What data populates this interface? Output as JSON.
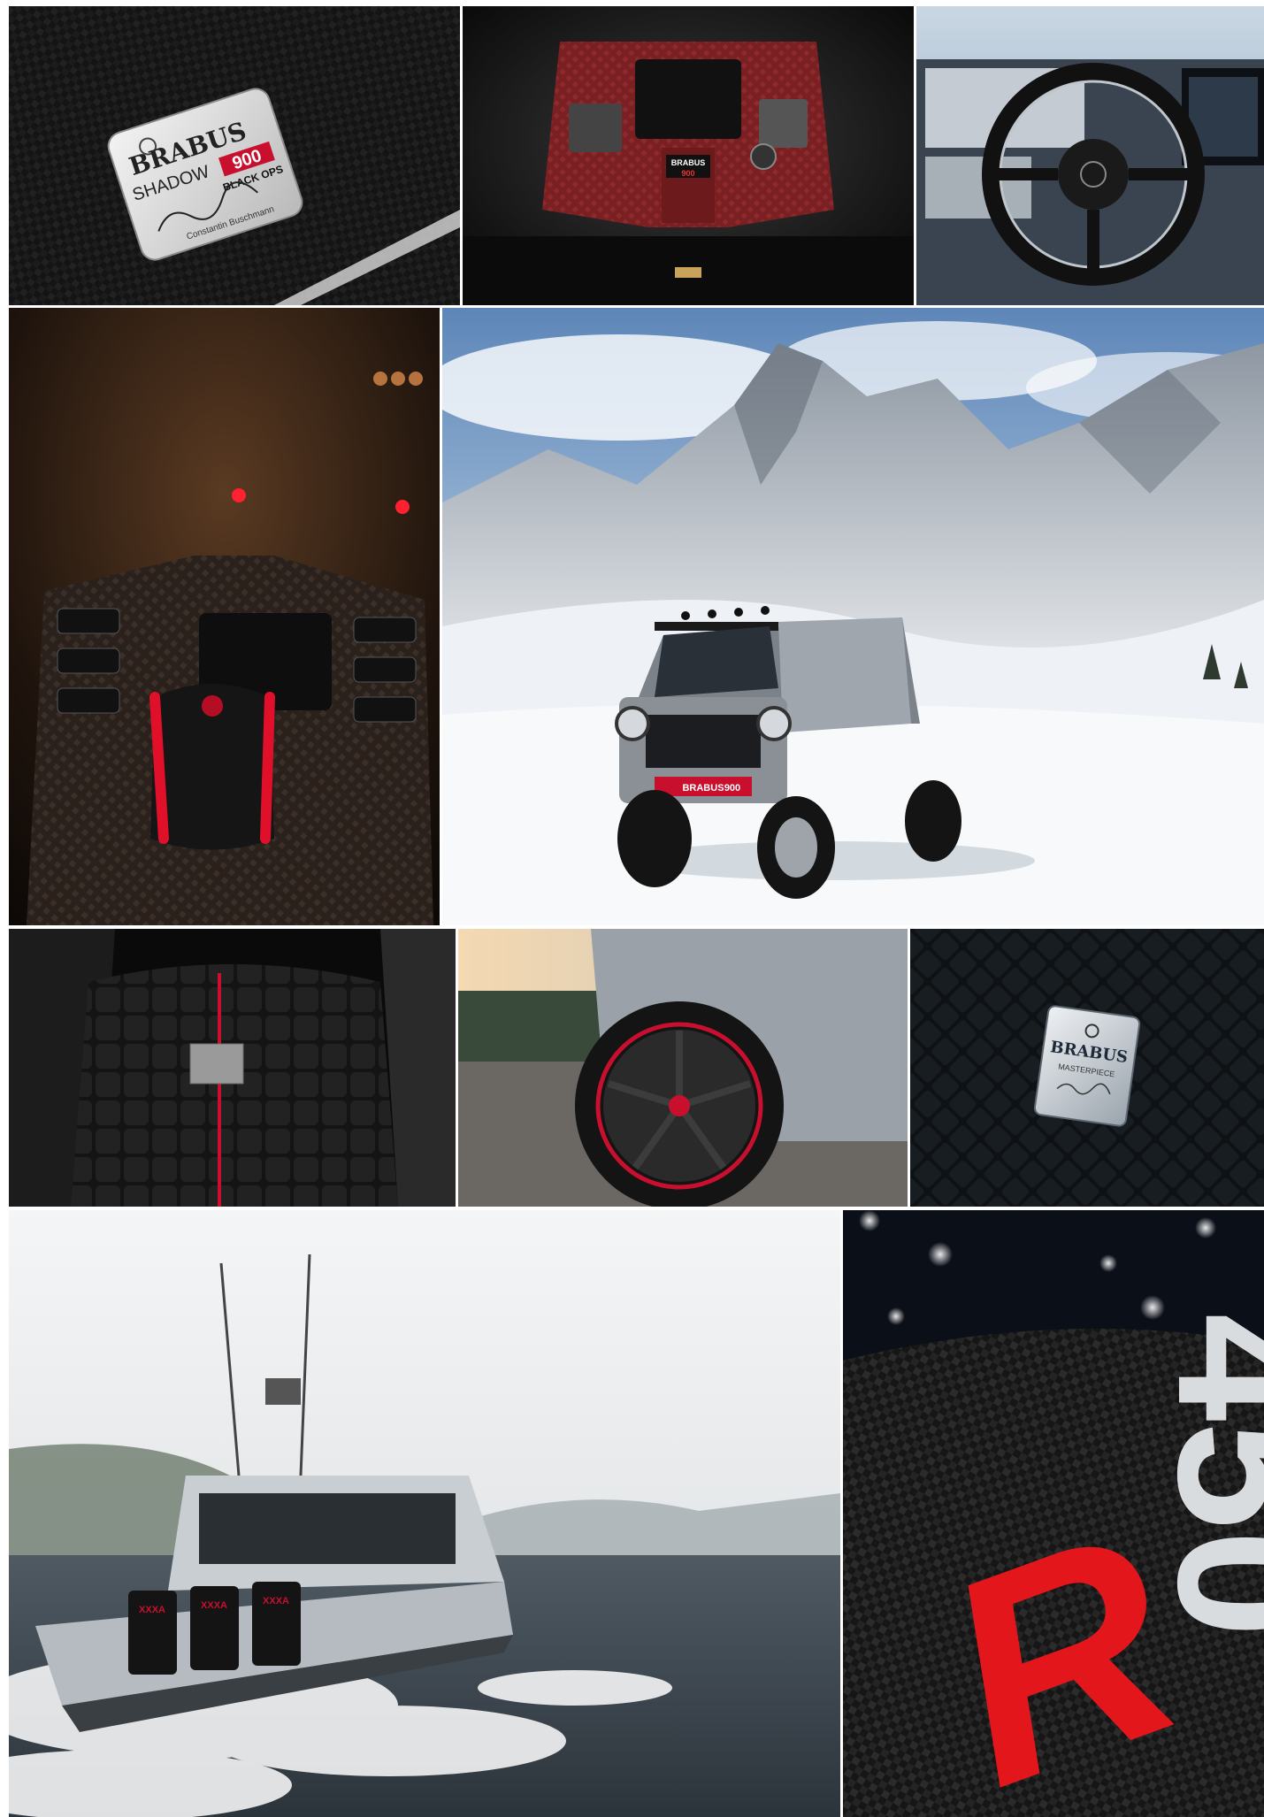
{
  "gallery": {
    "tiles": [
      {
        "subject": "carbon-badge"
      },
      {
        "subject": "engine-bay"
      },
      {
        "subject": "boat-helm"
      },
      {
        "subject": "gear-selector"
      },
      {
        "subject": "g-class-in-snow"
      },
      {
        "subject": "quilted-seat"
      },
      {
        "subject": "wheel-closeup"
      },
      {
        "subject": "masterpiece-plaque"
      },
      {
        "subject": "speedboat"
      },
      {
        "subject": "450r-carbon-badge"
      }
    ]
  },
  "badge1": {
    "brand": "BRABUS",
    "model": "SHADOW",
    "number": "900",
    "edition": "BLACK OPS",
    "signer": "Constantin Buschmann"
  },
  "engine": {
    "brand": "BRABUS",
    "number": "900"
  },
  "suv_plate": {
    "brand": "BRABUS",
    "number": "900"
  },
  "plaque": {
    "brand": "BRABUS",
    "label": "MASTERPIECE"
  },
  "boat": {
    "engine_brand": "XXXA"
  },
  "carbon_badge": {
    "digits": "450",
    "letter": "R"
  },
  "colors": {
    "accent_red": "#c8102e",
    "carbon": "#1a1a1a",
    "snow": "#eef2f6"
  }
}
